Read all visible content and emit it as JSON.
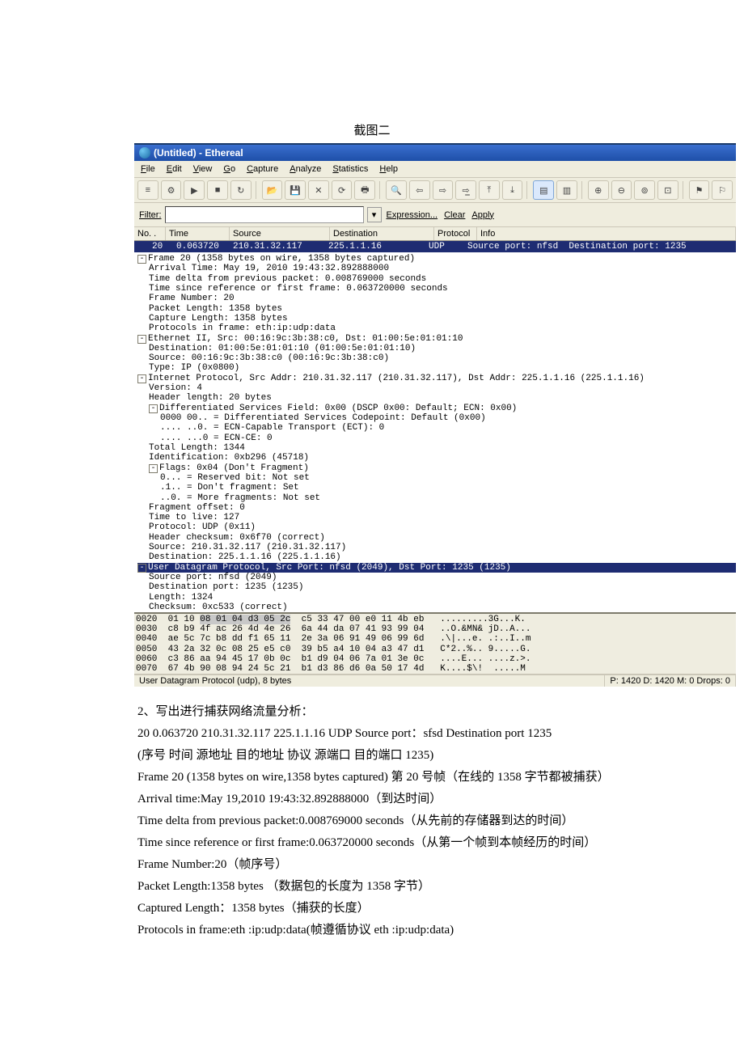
{
  "caption": "截图二",
  "titlebar": {
    "text": "(Untitled) - Ethereal"
  },
  "menubar": [
    "File",
    "Edit",
    "View",
    "Go",
    "Capture",
    "Analyze",
    "Statistics",
    "Help"
  ],
  "filter": {
    "label": "Filter:",
    "expression": "Expression...",
    "clear": "Clear",
    "apply": "Apply",
    "placeholder": ""
  },
  "columns": {
    "no": "No. .",
    "time": "Time",
    "source": "Source",
    "destination": "Destination",
    "protocol": "Protocol",
    "info": "Info"
  },
  "selected_row": {
    "no": "20",
    "time": "0.063720",
    "source": "210.31.32.117",
    "destination": "225.1.1.16",
    "protocol": "UDP",
    "info": "Source port: nfsd  Destination port: 1235"
  },
  "details": [
    {
      "lvl": 0,
      "box": "-",
      "t": "Frame 20 (1358 bytes on wire, 1358 bytes captured)"
    },
    {
      "lvl": 1,
      "t": "Arrival Time: May 19, 2010 19:43:32.892888000"
    },
    {
      "lvl": 1,
      "t": "Time delta from previous packet: 0.008769000 seconds"
    },
    {
      "lvl": 1,
      "t": "Time since reference or first frame: 0.063720000 seconds"
    },
    {
      "lvl": 1,
      "t": "Frame Number: 20"
    },
    {
      "lvl": 1,
      "t": "Packet Length: 1358 bytes"
    },
    {
      "lvl": 1,
      "t": "Capture Length: 1358 bytes"
    },
    {
      "lvl": 1,
      "t": "Protocols in frame: eth:ip:udp:data"
    },
    {
      "lvl": 0,
      "box": "-",
      "t": "Ethernet II, Src: 00:16:9c:3b:38:c0, Dst: 01:00:5e:01:01:10"
    },
    {
      "lvl": 1,
      "t": "Destination: 01:00:5e:01:01:10 (01:00:5e:01:01:10)"
    },
    {
      "lvl": 1,
      "t": "Source: 00:16:9c:3b:38:c0 (00:16:9c:3b:38:c0)"
    },
    {
      "lvl": 1,
      "t": "Type: IP (0x0800)"
    },
    {
      "lvl": 0,
      "box": "-",
      "t": "Internet Protocol, Src Addr: 210.31.32.117 (210.31.32.117), Dst Addr: 225.1.1.16 (225.1.1.16)"
    },
    {
      "lvl": 1,
      "t": "Version: 4"
    },
    {
      "lvl": 1,
      "t": "Header length: 20 bytes"
    },
    {
      "lvl": 1,
      "box": "-",
      "t": "Differentiated Services Field: 0x00 (DSCP 0x00: Default; ECN: 0x00)"
    },
    {
      "lvl": 2,
      "t": "0000 00.. = Differentiated Services Codepoint: Default (0x00)"
    },
    {
      "lvl": 2,
      "t": ".... ..0. = ECN-Capable Transport (ECT): 0"
    },
    {
      "lvl": 2,
      "t": ".... ...0 = ECN-CE: 0"
    },
    {
      "lvl": 1,
      "t": "Total Length: 1344"
    },
    {
      "lvl": 1,
      "t": "Identification: 0xb296 (45718)"
    },
    {
      "lvl": 1,
      "box": "-",
      "t": "Flags: 0x04 (Don't Fragment)"
    },
    {
      "lvl": 2,
      "t": "0... = Reserved bit: Not set"
    },
    {
      "lvl": 2,
      "t": ".1.. = Don't fragment: Set"
    },
    {
      "lvl": 2,
      "t": "..0. = More fragments: Not set"
    },
    {
      "lvl": 1,
      "t": "Fragment offset: 0"
    },
    {
      "lvl": 1,
      "t": "Time to live: 127"
    },
    {
      "lvl": 1,
      "t": "Protocol: UDP (0x11)"
    },
    {
      "lvl": 1,
      "t": "Header checksum: 0x6f70 (correct)"
    },
    {
      "lvl": 1,
      "t": "Source: 210.31.32.117 (210.31.32.117)"
    },
    {
      "lvl": 1,
      "t": "Destination: 225.1.1.16 (225.1.1.16)"
    },
    {
      "lvl": 0,
      "box": "-",
      "sel": true,
      "t": "User Datagram Protocol, Src Port: nfsd (2049), Dst Port: 1235 (1235)"
    },
    {
      "lvl": 1,
      "t": "Source port: nfsd (2049)"
    },
    {
      "lvl": 1,
      "t": "Destination port: 1235 (1235)"
    },
    {
      "lvl": 1,
      "t": "Length: 1324"
    },
    {
      "lvl": 1,
      "t": "Checksum: 0xc533 (correct)"
    }
  ],
  "hex": [
    {
      "off": "0020",
      "b1": "01 10 ",
      "hl": "08 01 04 d3 05 2c",
      "b2": "  c5 33 47 00 e0 11 4b eb",
      "asc": "   .........3G...K."
    },
    {
      "off": "0030",
      "b1": "c8 b9 4f ac 26 4d 4e 26",
      "b2": "  6a 44 da 07 41 93 99 04",
      "asc": "   ..O.&MN& jD..A..."
    },
    {
      "off": "0040",
      "b1": "ae 5c 7c b8 dd f1 65 11",
      "b2": "  2e 3a 06 91 49 06 99 6d",
      "asc": "   .\\|...e. .:..I..m"
    },
    {
      "off": "0050",
      "b1": "43 2a 32 0c 08 25 e5 c0",
      "b2": "  39 b5 a4 10 04 a3 47 d1",
      "asc": "   C*2..%.. 9.....G."
    },
    {
      "off": "0060",
      "b1": "c3 86 aa 94 45 17 0b 0c",
      "b2": "  b1 d9 04 06 7a 01 3e 0c",
      "asc": "   ....E... ....z.>."
    },
    {
      "off": "0070",
      "b1": "67 4b 90 08 94 24 5c 21",
      "b2": "  b1 d3 86 d6 0a 50 17 4d",
      "asc": "   K....$\\!  .....M"
    }
  ],
  "statusbar": {
    "left": "User Datagram Protocol (udp), 8 bytes",
    "right": "P: 1420 D: 1420 M: 0 Drops: 0"
  },
  "doc": [
    "    2、写出进行捕获网络流量分析：",
    "  20    0.063720    210.31.32.117    225.1.1.16 UDP Source port：sfsd Destination port 1235",
    "  (序号  时间           源地址         目的地址  协议         源端口                  目的端口 1235)",
    "Frame 20 (1358 bytes on wire,1358 bytes captured)  第 20 号帧（在线的 1358 字节都被捕获）",
    "Arrival time:May 19,2010 19:43:32.892888000（到达时间）",
    "Time delta from previous packet:0.008769000 seconds（从先前的存储器到达的时间）",
    "Time since reference or first frame:0.063720000 seconds（从第一个帧到本帧经历的时间）",
    "Frame Number:20（帧序号）",
    "Packet Length:1358 bytes  （数据包的长度为 1358 字节）",
    "Captured Length：1358 bytes（捕获的长度）",
    "Protocols in frame:eth :ip:udp:data(帧遵循协议 eth :ip:udp:data)"
  ]
}
